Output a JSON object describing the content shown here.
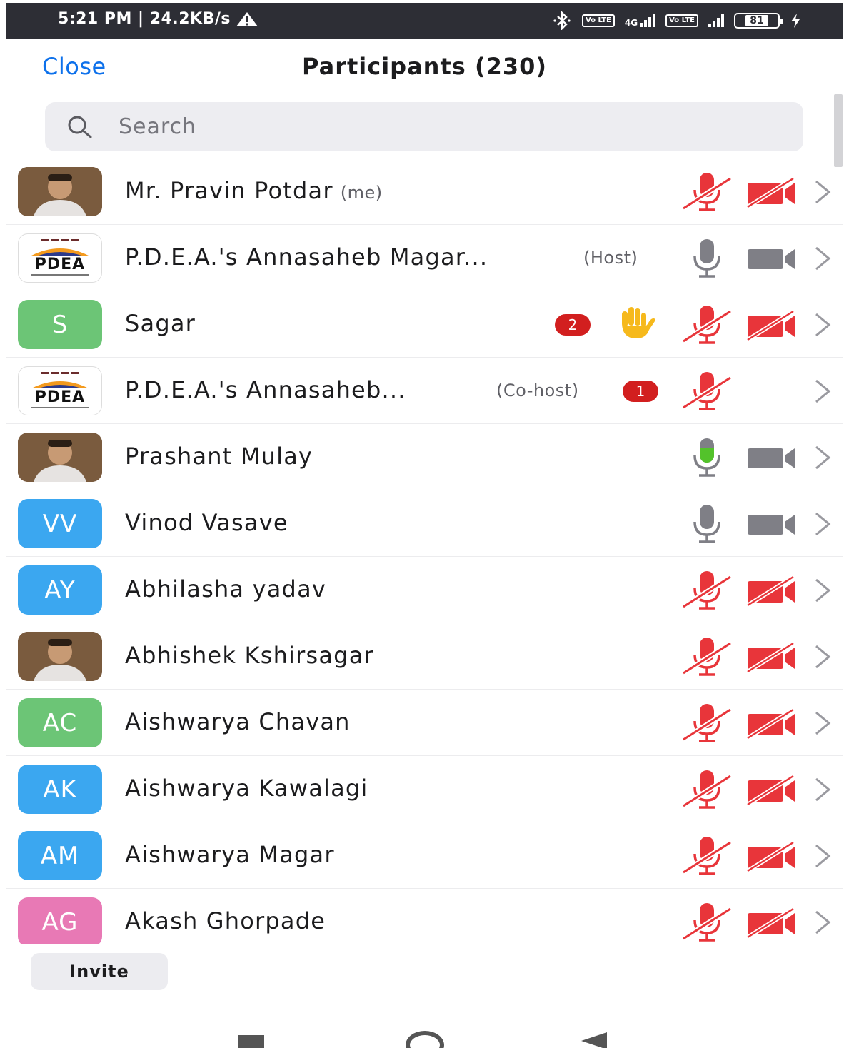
{
  "status_bar": {
    "time_speed": "5:21 PM | 24.2KB/s",
    "network_type": "4G",
    "volte_label": "Vo LTE",
    "battery": "81"
  },
  "header": {
    "close_label": "Close",
    "title": "Participants (230)"
  },
  "search": {
    "placeholder": "Search",
    "value": ""
  },
  "participants": [
    {
      "name": "Mr. Pravin Potdar",
      "tag": "(me)",
      "avatar": "photo",
      "mic": "muted",
      "video": "off"
    },
    {
      "name": "P.D.E.A.'s Annasaheb Magar...",
      "tag": "(Host)",
      "avatar": "PDEA",
      "mic": "idle",
      "video": "on"
    },
    {
      "name": "Sagar",
      "initials": "S",
      "avatar_color": "#6cc576",
      "badge": "2",
      "hand_raised": true,
      "mic": "muted",
      "video": "off"
    },
    {
      "name": "P.D.E.A.'s Annasaheb...",
      "tag": "(Co-host)",
      "avatar": "PDEA",
      "badge": "1",
      "mic": "muted",
      "video": "none"
    },
    {
      "name": "Prashant Mulay",
      "avatar": "photo",
      "mic": "speaking",
      "video": "on"
    },
    {
      "name": "Vinod Vasave",
      "initials": "VV",
      "avatar_color": "#3ba7f0",
      "mic": "idle",
      "video": "on"
    },
    {
      "name": "Abhilasha yadav",
      "initials": "AY",
      "avatar_color": "#3ba7f0",
      "mic": "muted",
      "video": "off"
    },
    {
      "name": "Abhishek Kshirsagar",
      "avatar": "photo",
      "mic": "muted",
      "video": "off"
    },
    {
      "name": "Aishwarya Chavan",
      "initials": "AC",
      "avatar_color": "#6cc576",
      "mic": "muted",
      "video": "off"
    },
    {
      "name": "Aishwarya Kawalagi",
      "initials": "AK",
      "avatar_color": "#3ba7f0",
      "mic": "muted",
      "video": "off"
    },
    {
      "name": "Aishwarya Magar",
      "initials": "AM",
      "avatar_color": "#3ba7f0",
      "mic": "muted",
      "video": "off"
    },
    {
      "name": "Akash Ghorpade",
      "initials": "AG",
      "avatar_color": "#e879b5",
      "mic": "muted",
      "video": "off"
    }
  ],
  "footer": {
    "invite_label": "Invite"
  },
  "colors": {
    "accent_blue": "#0e71eb",
    "muted_red": "#e8353a",
    "speaking_green": "#53c22b",
    "icon_gray": "#7f7f86"
  }
}
